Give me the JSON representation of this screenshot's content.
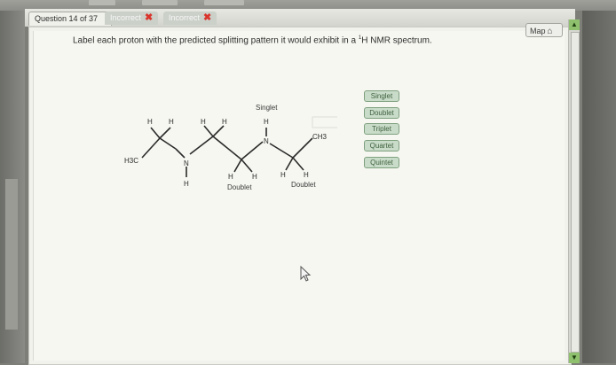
{
  "tabs": {
    "question_counter": "Question 14 of 37",
    "attempts": [
      {
        "label": "Incorrect",
        "mark": "✖"
      },
      {
        "label": "Incorrect",
        "mark": "✖"
      }
    ]
  },
  "map_button": {
    "label": "Map",
    "icon": "map-icon"
  },
  "question": {
    "text_before": "Label each proton with the predicted splitting pattern it would exhibit in a ",
    "sup": "1",
    "text_after": "H NMR spectrum."
  },
  "molecule": {
    "atoms": {
      "h3c": "H3C",
      "ch3": "CH3",
      "n1": "N",
      "n2": "N",
      "h": "H"
    },
    "placed_labels": {
      "nh_label": "Singlet",
      "left_ch2_label": "Doublet",
      "right_ch2_label": "Doublet"
    }
  },
  "label_bank": [
    "Singlet",
    "Doublet",
    "Triplet",
    "Quartet",
    "Quintet"
  ],
  "colors": {
    "chip_bg": "#c9dcc9",
    "chip_border": "#7ea07e",
    "incorrect_mark": "#d9352c",
    "scroll_green": "#8fc06e"
  }
}
